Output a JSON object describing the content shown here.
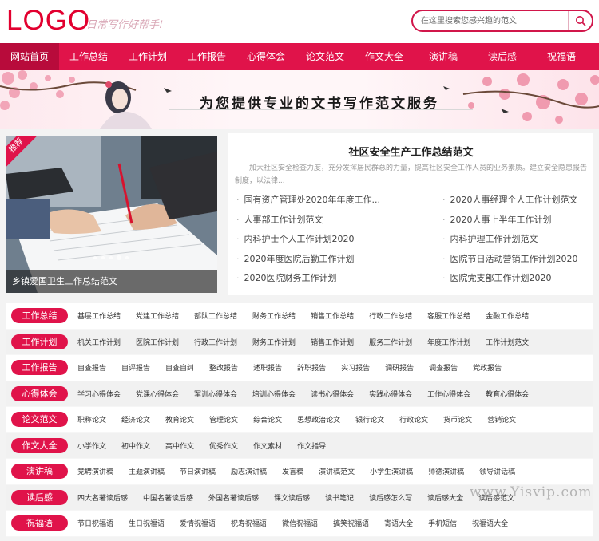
{
  "header": {
    "logo": "LOGO",
    "slogan": "日常写作好帮手!",
    "search_placeholder": "在这里搜索您感兴趣的范文"
  },
  "nav": [
    {
      "label": "网站首页",
      "active": true
    },
    {
      "label": "工作总结"
    },
    {
      "label": "工作计划"
    },
    {
      "label": "工作报告"
    },
    {
      "label": "心得体会"
    },
    {
      "label": "论文范文"
    },
    {
      "label": "作文大全"
    },
    {
      "label": "演讲稿"
    },
    {
      "label": "读后感"
    },
    {
      "label": "祝福语"
    }
  ],
  "banner": {
    "text": "为您提供专业的文书写作范文服务"
  },
  "featured": {
    "badge": "推荐",
    "caption": "乡镇爱国卫生工作总结范文"
  },
  "article": {
    "title": "社区安全生产工作总结范文",
    "summary": "加大社区安全检查力度，充分发挥居民群总的力量，提高社区安全工作人员的业务素质。建立安全隐患报告制度，以法律...",
    "links_left": [
      "国有资产管理处2020年年度工作...",
      "人事部工作计划范文",
      "内科护士个人工作计划2020",
      "2020年度医院后勤工作计划",
      "2020医院财务工作计划"
    ],
    "links_right": [
      "2020人事经理个人工作计划范文",
      "2020人事上半年工作计划",
      "内科护理工作计划范文",
      "医院节日活动营销工作计划2020",
      "医院党支部工作计划2020"
    ]
  },
  "categories": [
    {
      "label": "工作总结",
      "links": [
        "基层工作总结",
        "党建工作总结",
        "部队工作总结",
        "财务工作总结",
        "销售工作总结",
        "行政工作总结",
        "客服工作总结",
        "金融工作总结"
      ]
    },
    {
      "label": "工作计划",
      "links": [
        "机关工作计划",
        "医院工作计划",
        "行政工作计划",
        "财务工作计划",
        "销售工作计划",
        "服务工作计划",
        "年度工作计划",
        "工作计划范文"
      ]
    },
    {
      "label": "工作报告",
      "links": [
        "自查报告",
        "自评报告",
        "自查自纠",
        "整改报告",
        "述职报告",
        "辞职报告",
        "实习报告",
        "调研报告",
        "调查报告",
        "党政报告"
      ]
    },
    {
      "label": "心得体会",
      "links": [
        "学习心得体会",
        "党课心得体会",
        "军训心得体会",
        "培训心得体会",
        "读书心得体会",
        "实践心得体会",
        "工作心得体会",
        "教育心得体会"
      ]
    },
    {
      "label": "论文范文",
      "links": [
        "职称论文",
        "经济论文",
        "教育论文",
        "管理论文",
        "综合论文",
        "思想政治论文",
        "银行论文",
        "行政论文",
        "货币论文",
        "营销论文"
      ]
    },
    {
      "label": "作文大全",
      "links": [
        "小学作文",
        "初中作文",
        "高中作文",
        "优秀作文",
        "作文素材",
        "作文指导"
      ]
    },
    {
      "label": "演讲稿",
      "links": [
        "竞聘演讲稿",
        "主题演讲稿",
        "节日演讲稿",
        "励志演讲稿",
        "发言稿",
        "演讲稿范文",
        "小学生演讲稿",
        "师德演讲稿",
        "领导讲话稿"
      ]
    },
    {
      "label": "读后感",
      "links": [
        "四大名著读后感",
        "中国名著读后感",
        "外国名著读后感",
        "课文读后感",
        "读书笔记",
        "读后感怎么写",
        "读后感大全",
        "读后感范文"
      ]
    },
    {
      "label": "祝福语",
      "links": [
        "节日祝福语",
        "生日祝福语",
        "爱情祝福语",
        "祝寿祝福语",
        "微信祝福语",
        "搞笑祝福语",
        "寄语大全",
        "手机短信",
        "祝福语大全"
      ]
    }
  ],
  "watermark": "www.Yisvip.com"
}
